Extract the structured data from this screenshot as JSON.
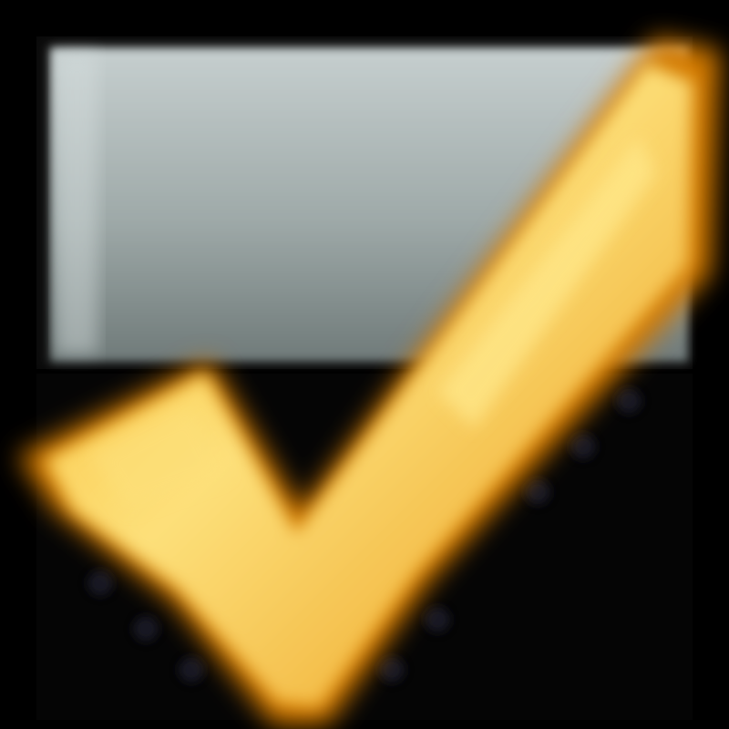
{
  "icon": {
    "name": "checked-box-icon",
    "parts": [
      "gray-box",
      "gold-checkmark"
    ]
  },
  "colors": {
    "background": "#000000",
    "box_light": "#c6cfcf",
    "box_mid": "#9ea9a8",
    "box_dark": "#6f7a79",
    "check_light": "#fde07a",
    "check_mid": "#f8b828",
    "check_dark": "#d47a05"
  }
}
